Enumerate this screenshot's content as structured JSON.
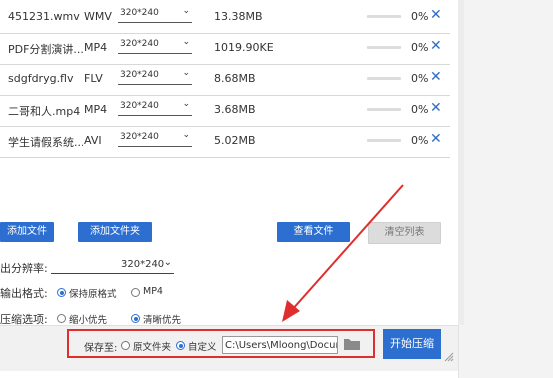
{
  "files": [
    {
      "name": "451231.wmv",
      "format": "WMV",
      "resolution": "320*240",
      "size": "13.38MB",
      "percent": "0%",
      "progress": 0
    },
    {
      "name": "PDF分割演讲...",
      "format": "MP4",
      "resolution": "320*240",
      "size": "1019.90KE",
      "percent": "0%",
      "progress": 0
    },
    {
      "name": "sdgfdryg.flv",
      "format": "FLV",
      "resolution": "320*240",
      "size": "8.68MB",
      "percent": "0%",
      "progress": 0
    },
    {
      "name": "二哥和人.mp4",
      "format": "MP4",
      "resolution": "320*240",
      "size": "3.68MB",
      "percent": "0%",
      "progress": 0
    },
    {
      "name": "学生请假系统...",
      "format": "AVI",
      "resolution": "320*240",
      "size": "5.02MB",
      "percent": "0%",
      "progress": 0
    }
  ],
  "delete_glyph": "✕",
  "dropdown_glyph": "⌄",
  "toolbar": {
    "add_file": "添加文件",
    "add_folder": "添加文件夹",
    "view_file": "查看文件",
    "clear_list": "清空列表"
  },
  "settings": {
    "resolution_label": "出分辨率:",
    "resolution_value": "320*240",
    "format_label": "输出格式:",
    "format_options": [
      "保持原格式",
      "MP4"
    ],
    "format_selected": 0,
    "compress_label": "压缩选项:",
    "compress_options": [
      "缩小优先",
      "清晰优先"
    ],
    "compress_selected": 1
  },
  "save": {
    "label": "保存至:",
    "options": [
      "原文件夹",
      "自定义"
    ],
    "selected": 1,
    "path": "C:\\Users\\Mloong\\Docume"
  },
  "start_button": "开始压缩",
  "icons": {
    "folder": "folder-icon",
    "delete": "close-icon",
    "dropdown": "chevron-down-icon",
    "resize": "resize-grip-icon"
  },
  "colors": {
    "accent": "#2d6fd0",
    "highlight": "#e02d2d"
  }
}
